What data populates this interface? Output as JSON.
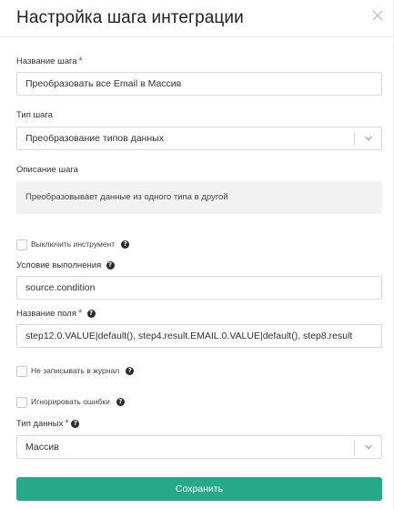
{
  "dialog": {
    "title": "Настройка шага интеграции"
  },
  "step_name": {
    "label": "Название шага",
    "value": "Преобразовать все Email в Массив"
  },
  "step_type": {
    "label": "Тип шага",
    "value": "Преобразование типов данных"
  },
  "step_description": {
    "label": "Описание шага",
    "text": "Преобразовывает данные из одного типа в другой"
  },
  "disable_tool": {
    "label": "Выключить инструмент",
    "checked": false
  },
  "condition": {
    "label": "Условие выполнения",
    "value": "source.condition"
  },
  "field_name": {
    "label": "Название поля",
    "value": "step12.0.VALUE|default(), step4.result.EMAIL.0.VALUE|default(), step8.result"
  },
  "no_log": {
    "label": "Не записывать в журнал",
    "checked": false
  },
  "ignore_errors": {
    "label": "Игнорировать ошибки",
    "checked": false
  },
  "data_type": {
    "label": "Тип данных",
    "value": "Массив"
  },
  "save_button": {
    "label": "Сохранить"
  },
  "colors": {
    "accent": "#27a889",
    "required": "#e0342a"
  },
  "icons": {
    "close": "close-icon",
    "help": "help-icon",
    "dropdown": "chevron-down-icon"
  }
}
